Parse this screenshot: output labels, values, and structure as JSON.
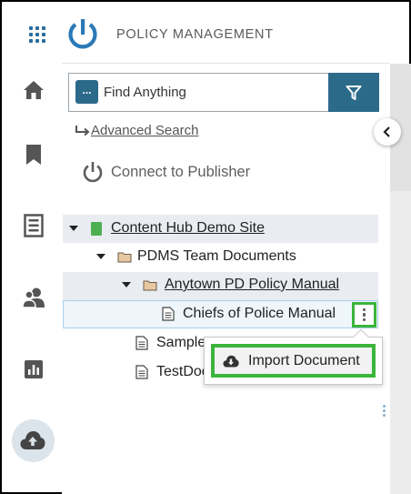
{
  "header": {
    "app_title": "POLICY MANAGEMENT",
    "menu_icon": "grid-icon",
    "logo_icon": "power-logo-icon"
  },
  "nav": {
    "items": [
      {
        "name": "home",
        "icon": "home-icon"
      },
      {
        "name": "bookmarks",
        "icon": "bookmark-icon"
      },
      {
        "name": "documents",
        "icon": "document-icon"
      },
      {
        "name": "users",
        "icon": "users-icon"
      },
      {
        "name": "reports",
        "icon": "bar-chart-icon"
      },
      {
        "name": "cloud-upload",
        "icon": "cloud-upload-icon",
        "active": true
      }
    ]
  },
  "search": {
    "dots_label": "...",
    "placeholder": "Find Anything",
    "filter_icon": "filter-icon"
  },
  "advanced_search": "Advanced Search",
  "connect": "Connect to Publisher",
  "tree": {
    "site": "Content Hub Demo Site",
    "folder_team": "PDMS Team Documents",
    "folder_manual": "Anytown PD Policy Manual",
    "doc_selected": "Chiefs of Police Manual",
    "doc_sample": "Sample",
    "doc_test": "TestDoc"
  },
  "popup": {
    "import_label": "Import Document",
    "import_icon": "cloud-download-icon"
  },
  "colors": {
    "accent": "#2c6a8a",
    "highlight": "#3bb53b",
    "site_icon": "#4caf50",
    "folder": "#c9a27a"
  }
}
